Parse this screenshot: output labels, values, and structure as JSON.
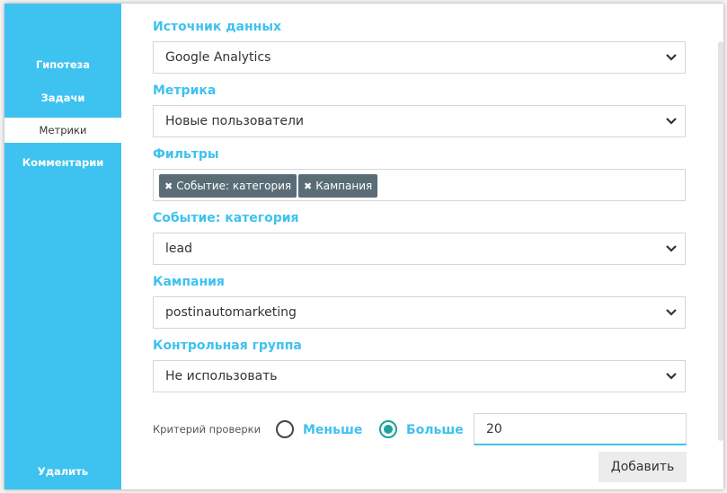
{
  "colors": {
    "accent": "#3ec2ef",
    "radio_active": "#1aa39a",
    "tag_bg": "#5a6c75"
  },
  "sidebar": {
    "items": [
      {
        "label": "Гипотеза",
        "active": false
      },
      {
        "label": "Задачи",
        "active": false
      },
      {
        "label": "Метрики",
        "active": true
      },
      {
        "label": "Комментарии",
        "active": false
      }
    ],
    "delete_label": "Удалить"
  },
  "form": {
    "data_source": {
      "label": "Источник данных",
      "value": "Google Analytics"
    },
    "metric": {
      "label": "Метрика",
      "value": "Новые пользователи"
    },
    "filters": {
      "label": "Фильтры",
      "tags": [
        "Событие: категория",
        "Кампания"
      ]
    },
    "event_category": {
      "label": "Событие: категория",
      "value": "lead"
    },
    "campaign": {
      "label": "Кампания",
      "value": "postinautomarketing"
    },
    "control_group": {
      "label": "Контрольная группа",
      "value": "Не использовать"
    },
    "criterion": {
      "label": "Критерий проверки",
      "options": [
        "Меньше",
        "Больше"
      ],
      "selected": "Больше",
      "threshold": "20"
    },
    "add_label": "Добавить"
  },
  "icons": {
    "chevron": "chevron-down-icon",
    "tag_remove": "close-icon"
  }
}
